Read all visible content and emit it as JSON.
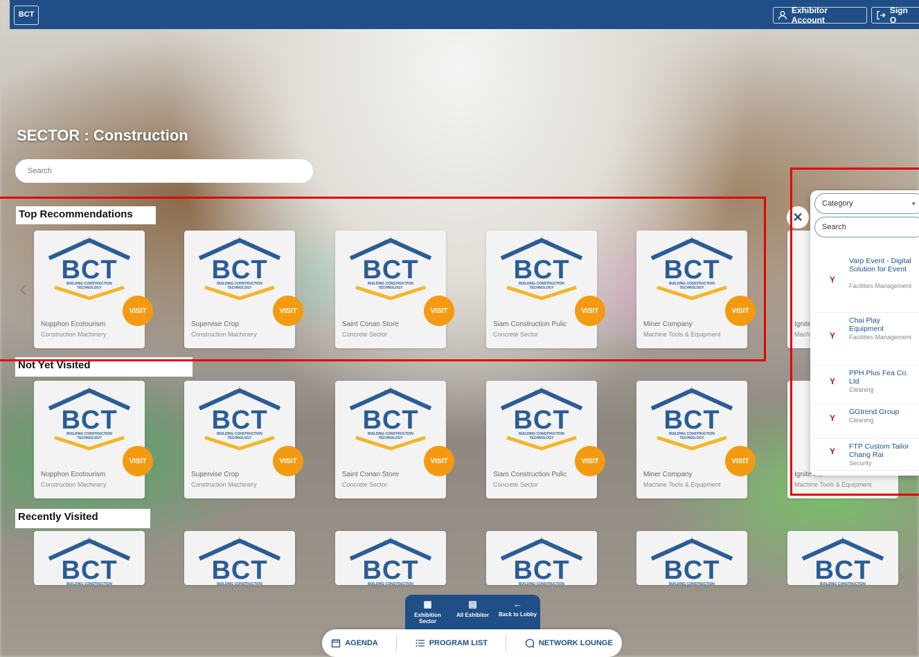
{
  "header": {
    "logo_text": "BCT",
    "exhibitor_account": "Exhibitor Account",
    "sign_out": "Sign O"
  },
  "sector": {
    "title": "SECTOR : Construction",
    "search_placeholder": "Search"
  },
  "sections": {
    "top_recommendations": "Top Recommendations",
    "not_yet_visited": "Not Yet Visited",
    "recently_visited": "Recently Visited"
  },
  "card_logo": {
    "brand": "BCT",
    "subtitle": "BUILDING CONSTRUCTION TECHNOLOGY"
  },
  "visit_label": "VISIT",
  "exhibitors": [
    {
      "name": "Nopphon Ecotourism",
      "category": "Construction Machinery"
    },
    {
      "name": "Supervise Crop",
      "category": "Construction Machinery"
    },
    {
      "name": "Saint Conan Store",
      "category": "Concrete Sector"
    },
    {
      "name": "Siam Construction Pulic",
      "category": "Concrete Sector"
    },
    {
      "name": "Miner Company",
      "category": "Machine Tools & Equipment"
    },
    {
      "name": "Ignite Ins",
      "category": "Machine Tools & Equipment"
    }
  ],
  "side_panel": {
    "category_label": "Category",
    "search_label": "Search",
    "items": [
      {
        "name": "Varp Event - Digital Solution for Event",
        "category": "Facilities Management"
      },
      {
        "name": "Chai Play Equipment",
        "category": "Facilities Management"
      },
      {
        "name": "PPH Plus Fea Co. Ltd",
        "category": "Cleaning"
      },
      {
        "name": "GGtrend Group",
        "category": "Cleaning"
      },
      {
        "name": "FTP Custom Tailor Chang Rai",
        "category": "Security"
      }
    ]
  },
  "bottom_nav": {
    "exhibition_sector": "Exhibition Sector",
    "all_exhibitor": "All Exhibitor",
    "back_to_lobby": "Back to Lobby"
  },
  "bottom_bar": {
    "agenda": "AGENDA",
    "program_list": "PROGRAM LIST",
    "network_lounge": "NETWORK LOUNGE"
  },
  "colors": {
    "primary": "#1f4f86",
    "accent": "#f39a11",
    "highlight": "#e30000"
  }
}
